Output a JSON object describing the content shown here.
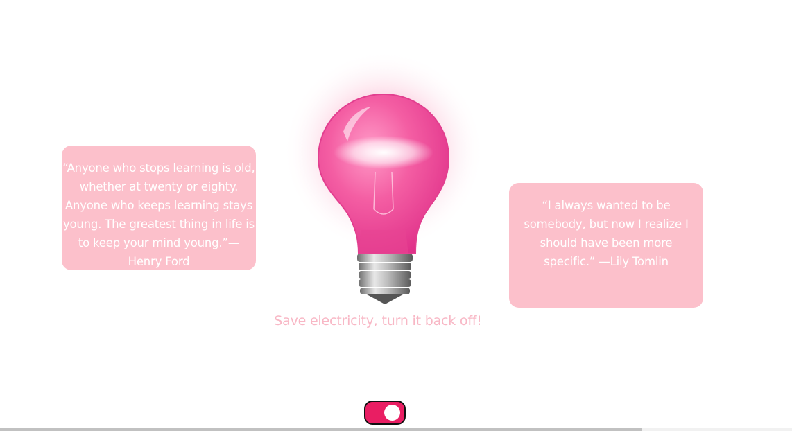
{
  "quotes": {
    "left": "“Anyone who stops learning is old, whether at twenty or eighty. Anyone who keeps learning stays young. The greatest thing in life is to keep your mind young.”—Henry Ford",
    "right": "“I always wanted to be somebody, but now I realize I should have been more specific.” —Lily Tomlin"
  },
  "bulb": {
    "icon": "lightbulb-icon",
    "state": "on",
    "color": "#f0569a"
  },
  "caption": "Save electricity, turn it back off!",
  "toggle": {
    "checked": true,
    "color": "#e91e63"
  },
  "scrollbar": {
    "fraction": 0.81
  }
}
